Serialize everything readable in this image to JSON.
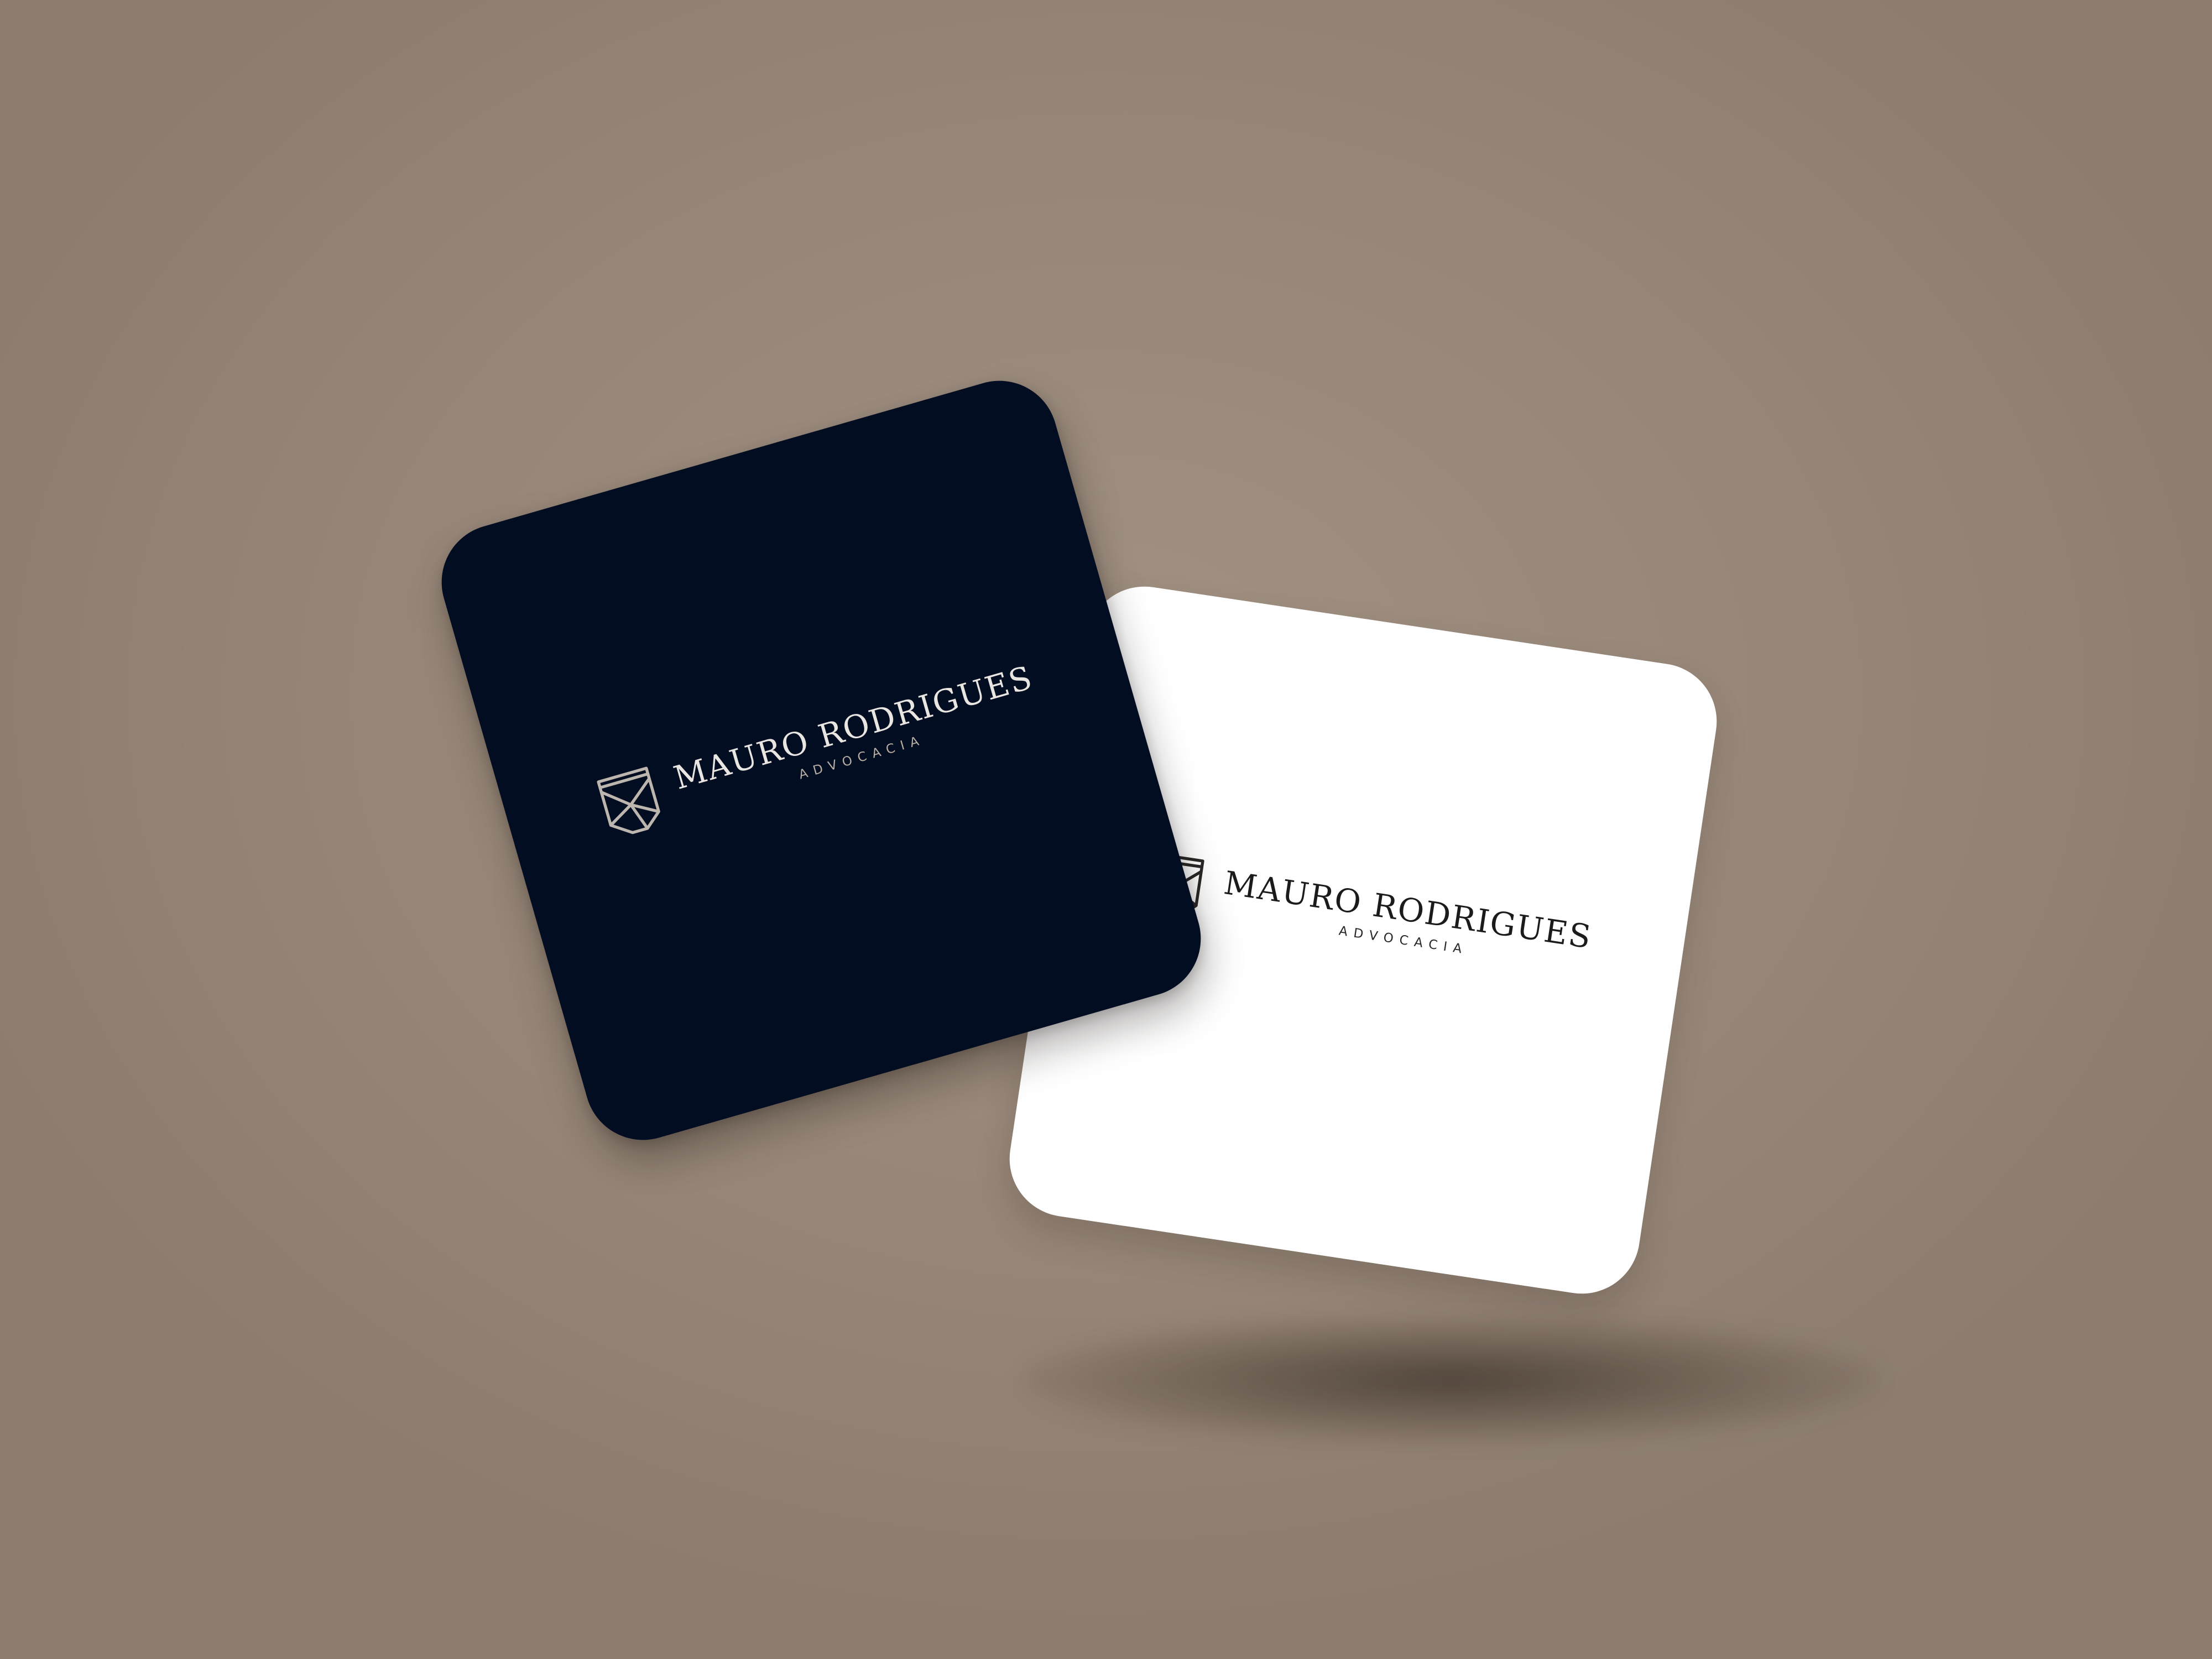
{
  "scene": {
    "background_color": "#9c8b7c"
  },
  "cards": [
    {
      "id": "dark",
      "background_color": "#020d22",
      "logo": {
        "name": "MAURO RODRIGUES",
        "tagline": "ADVOCACIA",
        "emblem_icon": "mr-monogram-shield-icon",
        "emblem_color": "#bdb6ae"
      }
    },
    {
      "id": "white",
      "background_color": "#ffffff",
      "logo": {
        "name": "MAURO RODRIGUES",
        "tagline": "ADVOCACIA",
        "emblem_icon": "mr-monogram-shield-icon",
        "emblem_color": "#2a2726"
      }
    }
  ]
}
